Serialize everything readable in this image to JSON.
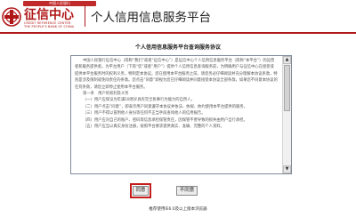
{
  "header": {
    "logo_tag": "中国人民银行",
    "logo_name": "征信中心",
    "logo_en_line1": "CREDIT REFERENCE CENTER",
    "logo_en_line2": "THE PEOPLE'S BANK OF CHINA",
    "platform_title": "个人信用信息服务平台",
    "accent_color": "#b01818"
  },
  "agreement": {
    "title": "个人信用信息服务平台查询服务协议",
    "paragraphs": [
      "中国人民银行征信中心（简称“我们”或者“征信中心”）是征信中心个人信用信息服务平台（简称“本平台”）的运营者和服务提供者。为平台用户（下简“您”或者“用户”）提供个人信用信息查询服务前，为明确用户与征信中心在接受或提供本平台服务时的权利义务，特制定本协议。您在使用本平台服务之前，请您务必仔细阅读并充分理解本协议条款，特别是涉及限制或免除责任的条款。您点击“同意”即视为您已仔细阅读并同意接受本协议全部条款。如果您不同意本协议的任何条款，请您立即停止使用本平台服务。",
      "第一条　用户的权利及义务",
      "（一）用户应保证为年满18周岁具有完全民事行为能力的自然人。",
      "（二）用户点击“同意”，即表示用户同意遵守本协议并依法、依规、依约使用本平台提供的服务。",
      "（三）用户不得以冒用他人身份等任何不正当手段查询他人的信用报告。",
      "（四）用户应对自己的账户、密码等信息承担保管责任，因保管不善导致的损失由用户自行承担。",
      "（五）用户应当以真实身份注册，按照平台要求提供真实、准确、完整的个人资料。"
    ]
  },
  "scrollbar": {
    "up_glyph": "▲",
    "down_glyph": "▼"
  },
  "buttons": {
    "agree": "同意",
    "disagree": "不同意"
  },
  "footer": {
    "note": "推荐使用IE6.0及以上版本浏览器"
  }
}
